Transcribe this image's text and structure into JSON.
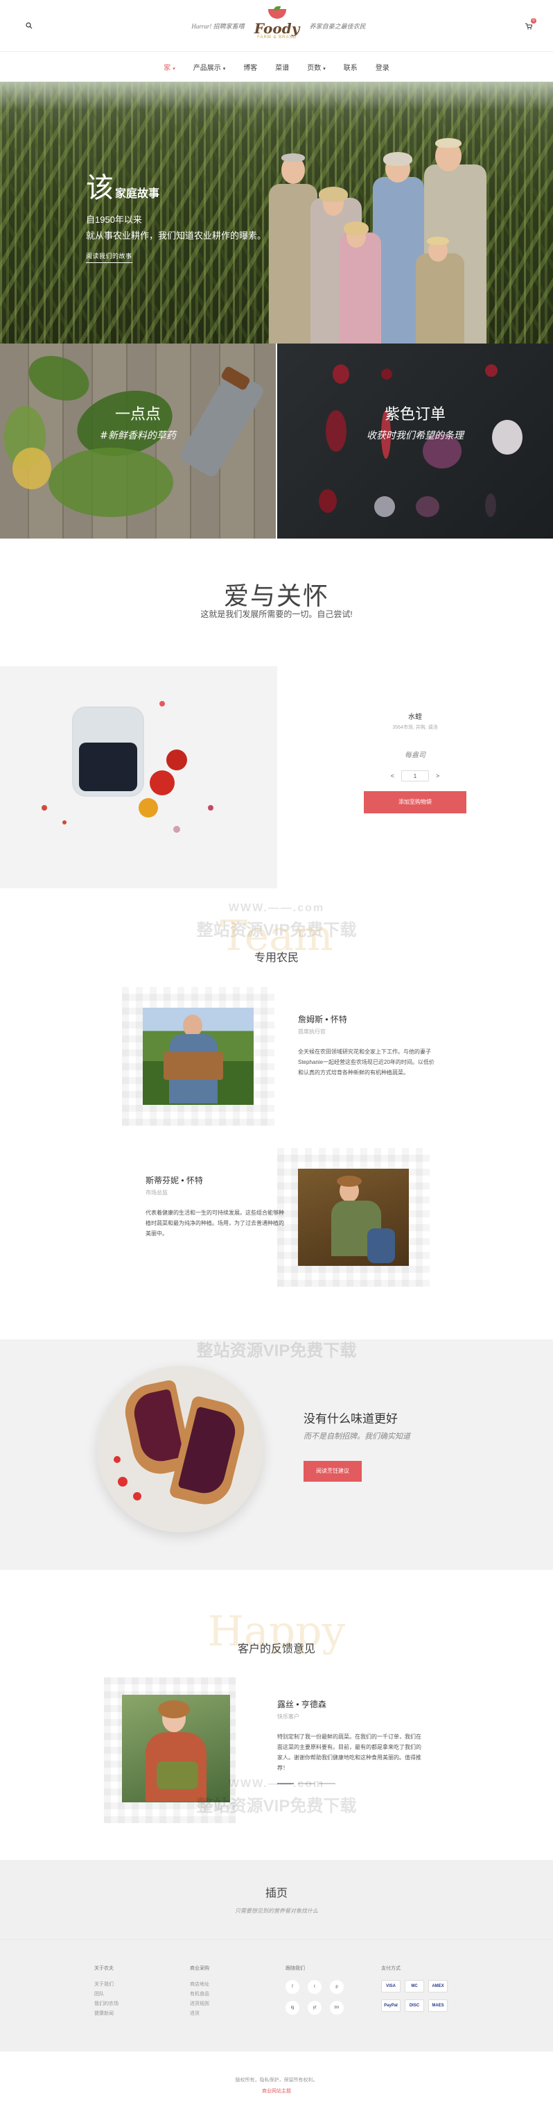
{
  "header": {
    "slogan_left": "Hurrar! 招聘家畜喂",
    "slogan_right": "养家自豪之最佳农民",
    "logo_text": "Foody",
    "logo_sub": "FARM & BRAND",
    "cart_count": "0"
  },
  "nav": {
    "items": [
      {
        "label": "家",
        "has_caret": true,
        "active": true
      },
      {
        "label": "产品展示",
        "has_caret": true,
        "active": false
      },
      {
        "label": "博客",
        "has_caret": false,
        "active": false
      },
      {
        "label": "菜谱",
        "has_caret": false,
        "active": false
      },
      {
        "label": "页数",
        "has_caret": true,
        "active": false
      },
      {
        "label": "联系",
        "has_caret": false,
        "active": false
      },
      {
        "label": "登录",
        "has_caret": false,
        "active": false
      }
    ]
  },
  "hero": {
    "big": "该",
    "title": "家庭故事",
    "line1": "自1950年以来",
    "line2": "就从事农业耕作，我们知道农业耕作的曝素。",
    "button": "阅读我们的故事"
  },
  "panels": [
    {
      "title": "一点点",
      "subtitle": "#新鲜香料的草药"
    },
    {
      "title": "紫色订单",
      "subtitle": "收获时我们希望的条理"
    }
  ],
  "love": {
    "title": "爱与关怀",
    "subtitle": "这就是我们发展所需要的一切。自己尝试!"
  },
  "product": {
    "name": "水蛭",
    "category": "3564市场, 并购, 调汤",
    "price": "每盎司",
    "qty": "1",
    "minus": "<",
    "plus": ">",
    "button": "添加至购物袋"
  },
  "watermark": {
    "line1": "WWW.——.com",
    "line2": "整站资源VIP免费下载"
  },
  "team": {
    "ghost": "Team",
    "title": "专用农民",
    "members": [
      {
        "name": "詹姆斯 • 怀特",
        "role": "首席执行官",
        "desc": "全天候在农田领域研究花和全家上下工作。与他的妻子Stephanie一起经营这些农场现已近20年的时间。以低价和认真的方式培育各种新鲜的有机种植蔬菜。"
      },
      {
        "name": "斯蒂芬妮 • 怀特",
        "role": "市场总监",
        "desc": "代表着健康的生活和一生的可持续发展。这些组合能够种植时蔬菜和最为纯净的种植。场用，为了过去普通种植的美丽中。"
      }
    ]
  },
  "tasty": {
    "title": "没有什么味道更好",
    "subtitle": "而不是自制招牌。我们确实知道",
    "button": "阅读烹饪建议"
  },
  "testimonial": {
    "ghost": "Happy",
    "title": "客户的反馈意见",
    "name": "露丝 • 亨德森",
    "role": "快乐客户",
    "text": "特别定制了我一份最鲜的蔬菜。在我们的一千订单，我们在面这菜的主要原料要有。目前，最有的都是拿来吃了我们的家人。谢谢你帮助我们健康地吃和这种食用美丽的。值得推荐！"
  },
  "pages": {
    "title": "插页",
    "subtitle": "只需要想见到的营养餐对象找什么"
  },
  "footer": {
    "cols": [
      {
        "title": "关于农夫",
        "items": [
          "关于我们",
          "团队",
          "我们的农场",
          "健康新闻"
        ]
      },
      {
        "title": "商业采购",
        "items": [
          "商店地址",
          "有机食品",
          "进货规则",
          "退货"
        ]
      }
    ],
    "social_title": "跟随我们",
    "socials": [
      "f",
      "t",
      "p",
      "ig",
      "yt",
      "tm"
    ],
    "pay_title": "支付方式",
    "cards": [
      "VISA",
      "MC",
      "AMEX",
      "PayPal",
      "DISC",
      "MAES"
    ]
  },
  "bottom": {
    "copyright": "版权所有，隐私保护，保留所有权利。",
    "credit": "商业网站主题"
  },
  "colors": {
    "accent": "#e25b5e"
  }
}
